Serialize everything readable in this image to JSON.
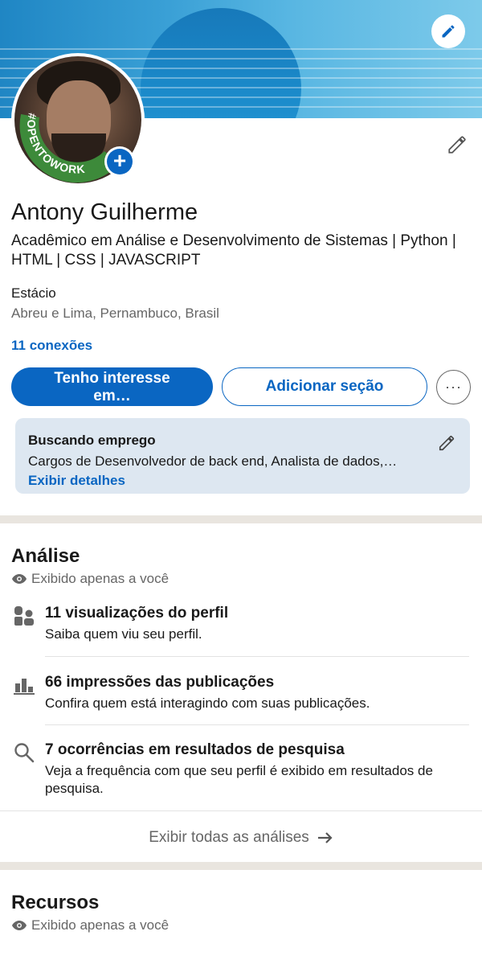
{
  "profile": {
    "name": "Antony Guilherme",
    "headline": "Acadêmico em Análise e Desenvolvimento de Sistemas | Python | HTML | CSS | JAVASCRIPT",
    "company": "Estácio",
    "location": "Abreu e Lima, Pernambuco, Brasil",
    "connections": "11 conexões",
    "avatar_badge": "#OPENTOWORK"
  },
  "actions": {
    "primary_label": "Tenho interesse em…",
    "secondary_label": "Adicionar seção",
    "more_label": "···"
  },
  "open_to_work": {
    "title": "Buscando emprego",
    "description": "Cargos de Desenvolvedor de back end, Analista de dados,…",
    "link": "Exibir detalhes"
  },
  "analytics": {
    "title": "Análise",
    "private_note": "Exibido apenas a você",
    "items": [
      {
        "icon": "people-icon",
        "title": "11 visualizações do perfil",
        "description": "Saiba quem viu seu perfil."
      },
      {
        "icon": "bar-chart-icon",
        "title": "66 impressões das publicações",
        "description": "Confira quem está interagindo com suas publicações."
      },
      {
        "icon": "search-icon",
        "title": "7 ocorrências em resultados de pesquisa",
        "description": "Veja a frequência com que seu perfil é exibido em resultados de pesquisa."
      }
    ],
    "show_all": "Exibir todas as análises"
  },
  "resources": {
    "title": "Recursos",
    "private_note": "Exibido apenas a você"
  },
  "colors": {
    "accent": "#0a66c2",
    "open_to_work_green": "#3d8a3a",
    "card_bg": "#dde7f1",
    "divider": "#e9e5df"
  }
}
